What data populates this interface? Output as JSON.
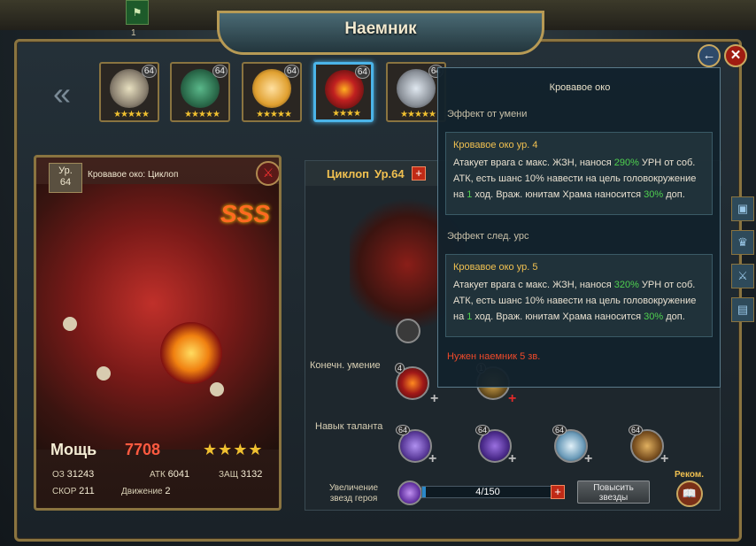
{
  "header": {
    "title": "Наемник",
    "top_count": "1"
  },
  "heroes": [
    {
      "level": "64",
      "stars": "★★★★★",
      "color": "#e8e0c0"
    },
    {
      "level": "64",
      "stars": "★★★★★",
      "color": "#3a8a6a"
    },
    {
      "level": "64",
      "stars": "★★★★★",
      "color": "#f0c860"
    },
    {
      "level": "64",
      "stars": "★★★★",
      "color": "#c02020",
      "selected": true
    },
    {
      "level": "64",
      "stars": "★★★★★",
      "color": "#c0c8d0"
    }
  ],
  "card": {
    "level_label": "Ур.",
    "level": "64",
    "name": "Кровавое око: Циклоп",
    "rank": "SSS",
    "power_label": "Мощь",
    "power_value": "7708",
    "stars": "★★★★",
    "stats": {
      "hp_label": "ОЗ",
      "hp": "31243",
      "atk_label": "АТК",
      "atk": "6041",
      "def_label": "ЗАЩ",
      "def": "3132",
      "speed_label": "СКОР",
      "speed": "211",
      "move_label": "Движение",
      "move": "2"
    }
  },
  "panel": {
    "hero_name": "Циклоп",
    "hero_level": "Ур.64",
    "ultimate_label": "Конечн. умение",
    "ultimate_level": "4",
    "ultimate_level_2": "1",
    "talent_label": "Навык таланта",
    "talent_levels": [
      "64",
      "64",
      "64",
      "64"
    ],
    "star_increase_label_1": "Увеличение",
    "star_increase_label_2": "звезд героя",
    "star_progress": "4/150",
    "star_progress_fraction": 0.027,
    "raise_btn_1": "Повысить",
    "raise_btn_2": "звезды",
    "recom_label": "Реком."
  },
  "tooltip": {
    "title": "Кровавое око",
    "current_label": "Эффект от умени",
    "current": {
      "title": "Кровавое око ур. 4",
      "l1_a": "Атакует врага с макс. ЖЗН, нанося ",
      "l1_pct": "290%",
      "l1_b": " УРН от соб.",
      "l2": "АТК, есть шанс 10% навести на цель головокружение",
      "l3_a": "на ",
      "l3_n": "1",
      "l3_b": " ход. Враж. юнитам Храма наносится ",
      "l3_pct": "30%",
      "l3_c": " доп."
    },
    "next_label": "Эффект след. урс",
    "next": {
      "title": "Кровавое око ур. 5",
      "l1_a": "Атакует врага с макс. ЖЗН, нанося ",
      "l1_pct": "320%",
      "l1_b": " УРН от соб.",
      "l2": "АТК, есть шанс 10% навести на цель головокружение",
      "l3_a": "на ",
      "l3_n": "1",
      "l3_b": " ход. Враж. юнитам Храма наносится ",
      "l3_pct": "30%",
      "l3_c": " доп."
    },
    "requirement": "Нужен наемник 5 зв."
  },
  "icons": {
    "back": "back-arrow-icon",
    "close": "close-icon",
    "nav_left": "double-chevron-left-icon"
  }
}
